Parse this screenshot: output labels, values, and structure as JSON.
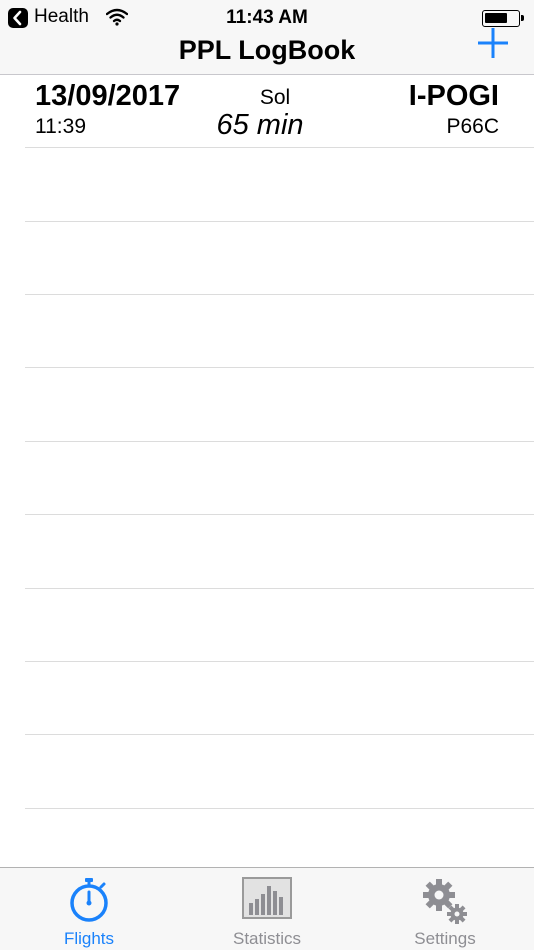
{
  "status_bar": {
    "back_app": "Health",
    "time": "11:43 AM"
  },
  "nav": {
    "title": "PPL LogBook"
  },
  "flights": [
    {
      "date": "13/09/2017",
      "time": "11:39",
      "type": "Sol",
      "duration": "65 min",
      "registration": "I-POGI",
      "aircraft": "P66C"
    }
  ],
  "tabs": [
    {
      "label": "Flights",
      "icon": "stopwatch-icon",
      "active": true
    },
    {
      "label": "Statistics",
      "icon": "bar-chart-icon",
      "active": false
    },
    {
      "label": "Settings",
      "icon": "gears-icon",
      "active": false
    }
  ],
  "colors": {
    "accent": "#1a82fb",
    "inactive": "#8e8e93",
    "separator": "#dcdcdc",
    "bar_background": "#f7f7f7"
  }
}
